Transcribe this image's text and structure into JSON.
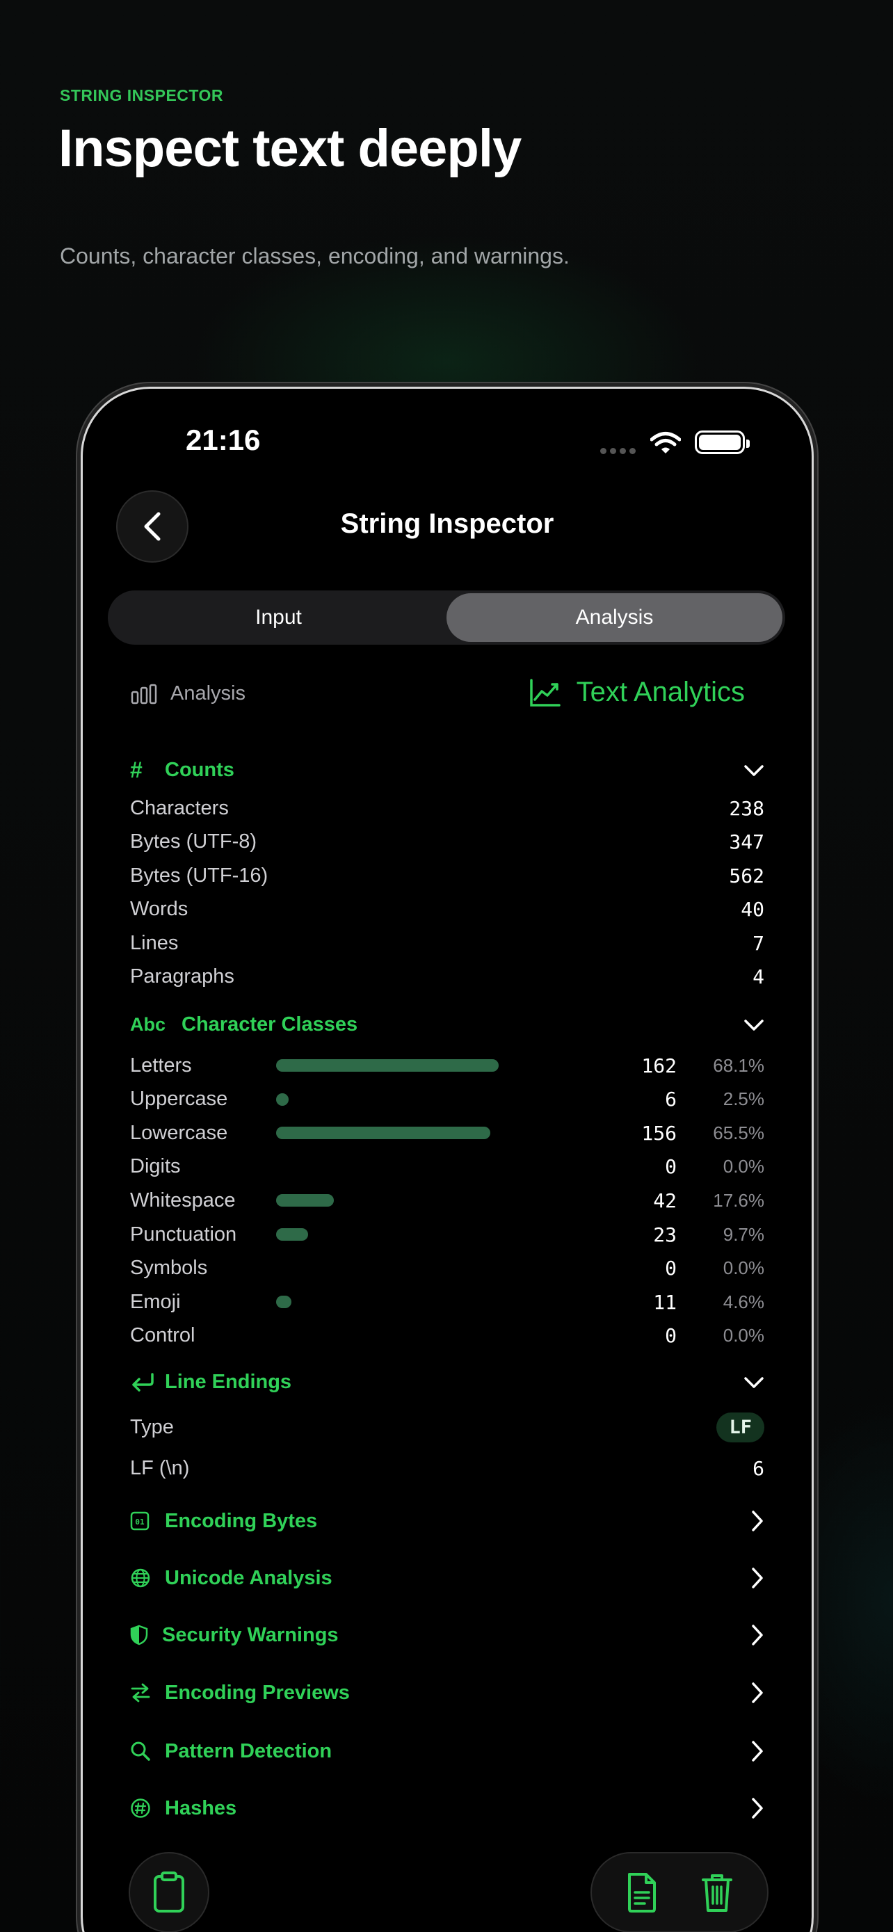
{
  "hero": {
    "eyebrow": "STRING INSPECTOR",
    "title": "Inspect text deeply",
    "subtitle": "Counts, character classes, encoding, and warnings."
  },
  "status_bar": {
    "time": "21:16"
  },
  "nav": {
    "title": "String Inspector",
    "back_icon": "chevron-left-icon"
  },
  "tabs": [
    {
      "label": "Input",
      "active": false
    },
    {
      "label": "Analysis",
      "active": true
    }
  ],
  "toolbar": {
    "left_label": "Analysis",
    "right_label": "Text Analytics"
  },
  "counts": {
    "title": "Counts",
    "rows": [
      {
        "label": "Characters",
        "value": "238"
      },
      {
        "label": "Bytes (UTF-8)",
        "value": "347"
      },
      {
        "label": "Bytes (UTF-16)",
        "value": "562"
      },
      {
        "label": "Words",
        "value": "40"
      },
      {
        "label": "Lines",
        "value": "7"
      },
      {
        "label": "Paragraphs",
        "value": "4"
      }
    ]
  },
  "character_classes": {
    "icon_text": "Abc",
    "title": "Character Classes",
    "rows": [
      {
        "label": "Letters",
        "count": "162",
        "percent": "68.1%",
        "fraction": 0.681
      },
      {
        "label": "Uppercase",
        "count": "6",
        "percent": "2.5%",
        "fraction": 0.025
      },
      {
        "label": "Lowercase",
        "count": "156",
        "percent": "65.5%",
        "fraction": 0.655
      },
      {
        "label": "Digits",
        "count": "0",
        "percent": "0.0%",
        "fraction": 0
      },
      {
        "label": "Whitespace",
        "count": "42",
        "percent": "17.6%",
        "fraction": 0.176
      },
      {
        "label": "Punctuation",
        "count": "23",
        "percent": "9.7%",
        "fraction": 0.097
      },
      {
        "label": "Symbols",
        "count": "0",
        "percent": "0.0%",
        "fraction": 0
      },
      {
        "label": "Emoji",
        "count": "11",
        "percent": "4.6%",
        "fraction": 0.046
      },
      {
        "label": "Control",
        "count": "0",
        "percent": "0.0%",
        "fraction": 0
      }
    ]
  },
  "line_endings": {
    "title": "Line Endings",
    "type_label": "Type",
    "type_value": "LF",
    "lf_label": "LF (\\n)",
    "lf_value": "6"
  },
  "links": [
    {
      "label": "Encoding Bytes",
      "icon": "binary-icon"
    },
    {
      "label": "Unicode Analysis",
      "icon": "globe-icon"
    },
    {
      "label": "Security Warnings",
      "icon": "shield-icon"
    },
    {
      "label": "Encoding Previews",
      "icon": "arrows-swap-icon"
    },
    {
      "label": "Pattern Detection",
      "icon": "search-icon"
    },
    {
      "label": "Hashes",
      "icon": "hash-icon"
    }
  ],
  "colors": {
    "accent": "#30d158",
    "bar": "#2e6a48",
    "background": "#000000"
  }
}
